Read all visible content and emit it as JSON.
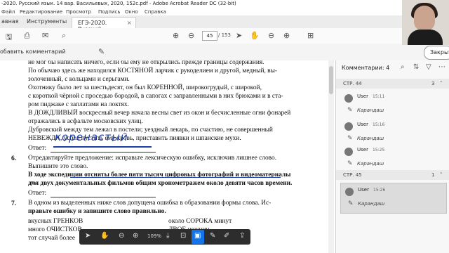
{
  "window": {
    "title": "-2020. Русский язык. 14 вар. Васильевых, 2020, 152с.pdf - Adobe Acrobat Reader DC (32-bit)"
  },
  "menu": [
    "Файл",
    "Редактирование",
    "Просмотр",
    "Подпись",
    "Окно",
    "Справка"
  ],
  "tabs": {
    "home": "авная",
    "tools": "Инструменты",
    "document": "ЕГЭ-2020. Русский...",
    "close": "×"
  },
  "toolbar": {
    "page_current": "45",
    "page_total": "/ 153"
  },
  "comment_bar": {
    "label": "обавить комментарий",
    "close_button": "Закрыть"
  },
  "document": {
    "lines": [
      "не мог бы написать ничего, если бы ему не открылись прежде границы содержания.",
      "По обычаю здесь же находился КОСТЯНОЙ ларчик с рукоделием и другой, медный, вы-",
      "золоченный, с кольцами и серьгами.",
      "Охотнику было лет за шестьдесят, он был КОРЕННОЙ, широкогрудый, с широкой,",
      "с короткой чёрной с проседью бородой, в сапогах с заправленными в них брюками и в ста-",
      "ром пиджаке с заплатами на локтях.",
      "В ДОЖДЛИВЫЙ воскресный вечер начала весны свет из окон и бесчисленные огни фонарей",
      "отражались в асфальте московских улиц.",
      "Дубровский между тем лежал в постели; уездный лекарь, по счастию, не совершенный",
      "НЕВЕЖДА, успел пустить ему кровь, приставить пиявки и шпанские мухи."
    ],
    "answer_label_5": "Ответ:",
    "answer_handwritten": "коренастый",
    "task6_number": "6.",
    "task6_line1": "Отредактируйте предложение: исправьте лексическую ошибку, исключив лишнее слово.",
    "task6_line2": "Выпишите это слово.",
    "task6_bold1": "В ходе экспедиции отсняты более пяти тысяч цифровых фотографий и видеоматериалы",
    "task6_bold2": "для двух документальных фильмов общим хронометражем около девяти часов времени.",
    "answer_label_6": "Ответ:",
    "task7_number": "7.",
    "task7_line1": "В одном из выделенных ниже слов допущена ошибка в образовании формы слова. Ис-",
    "task7_line2": "правьте ошибку и запишите слово правильно.",
    "words_left": [
      "вкусных ГРЕНКОВ",
      "много ОЧИСТКОВ",
      "тот случай более"
    ],
    "words_right": [
      "около СОРОКА минут",
      "ДВОЕ ножниц"
    ]
  },
  "comments": {
    "header": "Комментарии: 4",
    "groups": [
      {
        "label": "СТР. 44",
        "count": "3",
        "items": [
          {
            "user": "User",
            "time": "15:11",
            "type": "Карандаш"
          },
          {
            "user": "User",
            "time": "15:16",
            "type": "Карандаш"
          },
          {
            "user": "User",
            "time": "15:25",
            "type": "Карандаш"
          }
        ]
      },
      {
        "label": "СТР. 45",
        "count": "1",
        "items": [
          {
            "user": "User",
            "time": "15:26",
            "type": "Карандаш"
          }
        ]
      }
    ]
  },
  "floating_toolbar": {
    "zoom": "109%"
  },
  "colors": {
    "accent": "#1473e6",
    "ink": "#1f3fa8"
  }
}
